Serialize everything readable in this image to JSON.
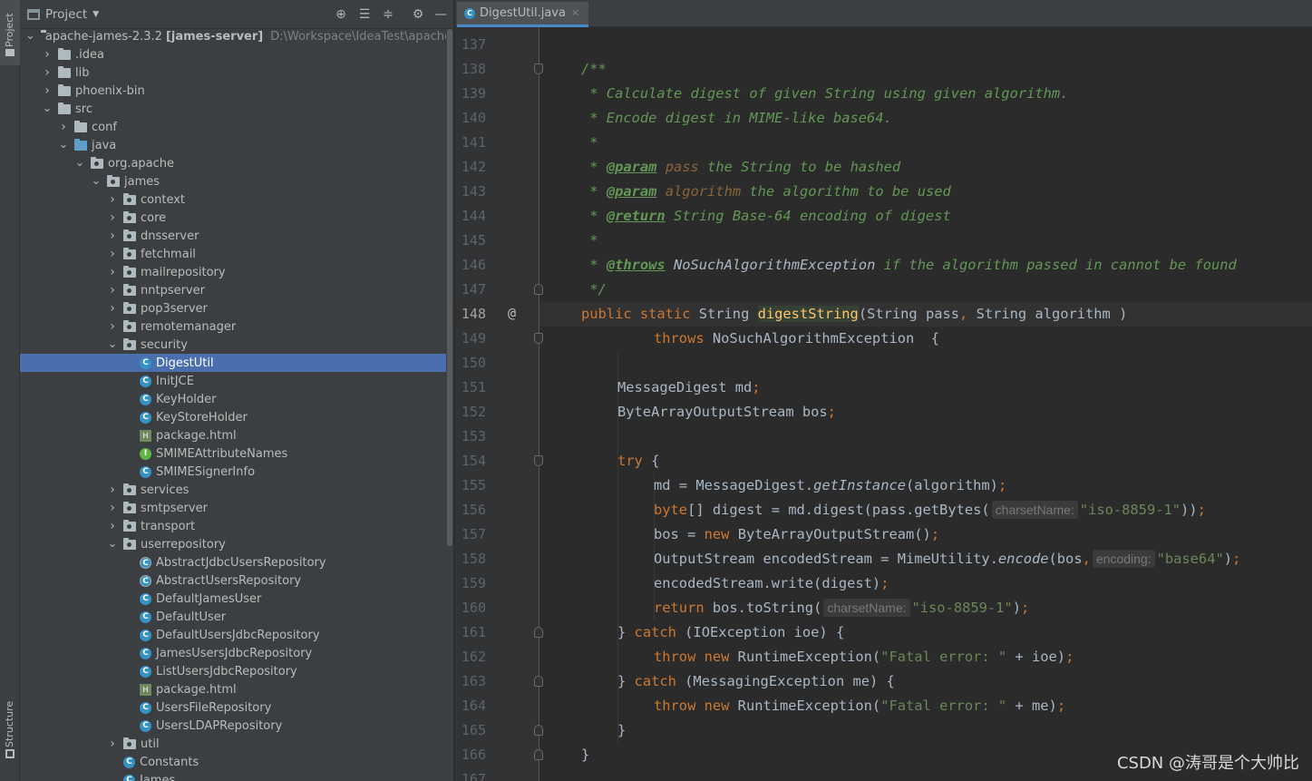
{
  "stripe": {
    "project_tab": "Project",
    "structure_tab": "Structure"
  },
  "project": {
    "title": "Project",
    "root": {
      "name": "apache-james-2.3.2",
      "module": "[james-server]",
      "path": "D:\\Workspace\\IdeaTest\\apache-ja"
    },
    "tree": [
      {
        "label": "apache-james-2.3.2",
        "depth": 0,
        "state": "open",
        "icon": "folder-module-icon",
        "root": true
      },
      {
        "label": ".idea",
        "depth": 1,
        "state": "closed",
        "icon": "folder-icon"
      },
      {
        "label": "lib",
        "depth": 1,
        "state": "closed",
        "icon": "folder-icon"
      },
      {
        "label": "phoenix-bin",
        "depth": 1,
        "state": "closed",
        "icon": "folder-icon"
      },
      {
        "label": "src",
        "depth": 1,
        "state": "open",
        "icon": "folder-icon"
      },
      {
        "label": "conf",
        "depth": 2,
        "state": "closed",
        "icon": "folder-icon"
      },
      {
        "label": "java",
        "depth": 2,
        "state": "open",
        "icon": "source-folder-icon"
      },
      {
        "label": "org.apache",
        "depth": 3,
        "state": "open",
        "icon": "package-icon"
      },
      {
        "label": "james",
        "depth": 4,
        "state": "open",
        "icon": "package-icon"
      },
      {
        "label": "context",
        "depth": 5,
        "state": "closed",
        "icon": "package-icon"
      },
      {
        "label": "core",
        "depth": 5,
        "state": "closed",
        "icon": "package-icon"
      },
      {
        "label": "dnsserver",
        "depth": 5,
        "state": "closed",
        "icon": "package-icon"
      },
      {
        "label": "fetchmail",
        "depth": 5,
        "state": "closed",
        "icon": "package-icon"
      },
      {
        "label": "mailrepository",
        "depth": 5,
        "state": "closed",
        "icon": "package-icon"
      },
      {
        "label": "nntpserver",
        "depth": 5,
        "state": "closed",
        "icon": "package-icon"
      },
      {
        "label": "pop3server",
        "depth": 5,
        "state": "closed",
        "icon": "package-icon"
      },
      {
        "label": "remotemanager",
        "depth": 5,
        "state": "closed",
        "icon": "package-icon"
      },
      {
        "label": "security",
        "depth": 5,
        "state": "open",
        "icon": "package-icon"
      },
      {
        "label": "DigestUtil",
        "depth": 6,
        "state": "leaf",
        "icon": "class-icon",
        "selected": true
      },
      {
        "label": "InitJCE",
        "depth": 6,
        "state": "leaf",
        "icon": "class-icon"
      },
      {
        "label": "KeyHolder",
        "depth": 6,
        "state": "leaf",
        "icon": "class-icon"
      },
      {
        "label": "KeyStoreHolder",
        "depth": 6,
        "state": "leaf",
        "icon": "class-icon"
      },
      {
        "label": "package.html",
        "depth": 6,
        "state": "leaf",
        "icon": "html-file-icon"
      },
      {
        "label": "SMIMEAttributeNames",
        "depth": 6,
        "state": "leaf",
        "icon": "interface-icon"
      },
      {
        "label": "SMIMESignerInfo",
        "depth": 6,
        "state": "leaf",
        "icon": "class-icon"
      },
      {
        "label": "services",
        "depth": 5,
        "state": "closed",
        "icon": "package-icon"
      },
      {
        "label": "smtpserver",
        "depth": 5,
        "state": "closed",
        "icon": "package-icon"
      },
      {
        "label": "transport",
        "depth": 5,
        "state": "closed",
        "icon": "package-icon"
      },
      {
        "label": "userrepository",
        "depth": 5,
        "state": "open",
        "icon": "package-icon"
      },
      {
        "label": "AbstractJdbcUsersRepository",
        "depth": 6,
        "state": "leaf",
        "icon": "abstract-class-icon"
      },
      {
        "label": "AbstractUsersRepository",
        "depth": 6,
        "state": "leaf",
        "icon": "abstract-class-icon"
      },
      {
        "label": "DefaultJamesUser",
        "depth": 6,
        "state": "leaf",
        "icon": "class-icon"
      },
      {
        "label": "DefaultUser",
        "depth": 6,
        "state": "leaf",
        "icon": "class-icon"
      },
      {
        "label": "DefaultUsersJdbcRepository",
        "depth": 6,
        "state": "leaf",
        "icon": "class-icon"
      },
      {
        "label": "JamesUsersJdbcRepository",
        "depth": 6,
        "state": "leaf",
        "icon": "class-icon"
      },
      {
        "label": "ListUsersJdbcRepository",
        "depth": 6,
        "state": "leaf",
        "icon": "class-icon"
      },
      {
        "label": "package.html",
        "depth": 6,
        "state": "leaf",
        "icon": "html-file-icon"
      },
      {
        "label": "UsersFileRepository",
        "depth": 6,
        "state": "leaf",
        "icon": "class-icon"
      },
      {
        "label": "UsersLDAPRepository",
        "depth": 6,
        "state": "leaf",
        "icon": "class-icon"
      },
      {
        "label": "util",
        "depth": 5,
        "state": "closed",
        "icon": "package-icon"
      },
      {
        "label": "Constants",
        "depth": 5,
        "state": "leaf",
        "icon": "class-icon"
      },
      {
        "label": "James",
        "depth": 5,
        "state": "leaf",
        "icon": "class-icon"
      }
    ]
  },
  "editor": {
    "tab_label": "DigestUtil.java",
    "current_line": 148,
    "line_numbers": [
      137,
      138,
      139,
      140,
      141,
      142,
      143,
      144,
      145,
      146,
      147,
      148,
      149,
      150,
      151,
      152,
      153,
      154,
      155,
      156,
      157,
      158,
      159,
      160,
      161,
      162,
      163,
      164,
      165,
      166,
      167
    ],
    "hints": {
      "charset": "charsetName:",
      "encoding": "encoding:"
    },
    "code": {
      "l138": "/**",
      "l139": " * Calculate digest of given String using given algorithm.",
      "l140": " * Encode digest in MIME-like base64.",
      "l141": " *",
      "l142_star": " * ",
      "l142_tag": "@param",
      "l142_param": "pass",
      "l142_rest": " the String to be hashed",
      "l143_star": " * ",
      "l143_tag": "@param",
      "l143_param": "algorithm",
      "l143_rest": " the algorithm to be used",
      "l144_star": " * ",
      "l144_tag": "@return",
      "l144_rest": " String Base-64 encoding of digest",
      "l145": " *",
      "l146_star": " * ",
      "l146_tag": "@throws",
      "l146_exc": "NoSuchAlgorithmException",
      "l146_rest": " if the algorithm passed in cannot be found",
      "l147": " */",
      "l148_kw": "public static",
      "l148_a": " String ",
      "l148_m": "digestString",
      "l148_b": "(String pass",
      "l148_c": ",",
      "l148_d": " String algorithm )",
      "l149_kw": "throws",
      "l149_rest": " NoSuchAlgorithmException  {",
      "l151_a": "MessageDigest md",
      "l151_b": ";",
      "l152_a": "ByteArrayOutputStream bos",
      "l152_b": ";",
      "l154_kw": "try",
      "l154_rest": " {",
      "l155_a": "md = MessageDigest.",
      "l155_m": "getInstance",
      "l155_b": "(algorithm)",
      "l155_c": ";",
      "l156_kw": "byte",
      "l156_a": "[] digest = md.digest(pass.getBytes(",
      "l156_s": "\"iso-8859-1\"",
      "l156_b": "))",
      "l156_c": ";",
      "l157_a": "bos = ",
      "l157_kw": "new",
      "l157_b": " ByteArrayOutputStream()",
      "l157_c": ";",
      "l158_a": "OutputStream encodedStream = MimeUtility.",
      "l158_m": "encode",
      "l158_b": "(bos",
      "l158_c": ",",
      "l158_s": "\"base64\"",
      "l158_d": ")",
      "l158_e": ";",
      "l159_a": "encodedStream.write(digest)",
      "l159_b": ";",
      "l160_kw": "return",
      "l160_a": " bos.toString(",
      "l160_s": "\"iso-8859-1\"",
      "l160_b": ")",
      "l160_c": ";",
      "l161_a": "} ",
      "l161_kw": "catch",
      "l161_b": " (IOException ioe) {",
      "l162_kw": "throw new",
      "l162_a": " RuntimeException(",
      "l162_s": "\"Fatal error: \"",
      "l162_b": " + ioe)",
      "l162_c": ";",
      "l163_a": "} ",
      "l163_kw": "catch",
      "l163_b": " (MessagingException me) {",
      "l164_kw": "throw new",
      "l164_a": " RuntimeException(",
      "l164_s": "\"Fatal error: \"",
      "l164_b": " + me)",
      "l164_c": ";",
      "l165": "}",
      "l166": "}"
    }
  },
  "watermark": "CSDN @涛哥是个大帅比",
  "colors": {
    "selection": "#4b6eaf",
    "keyword": "#cc7832",
    "comment": "#629755",
    "string": "#6a8759",
    "method": "#ffc66d",
    "text": "#a9b7c6"
  }
}
